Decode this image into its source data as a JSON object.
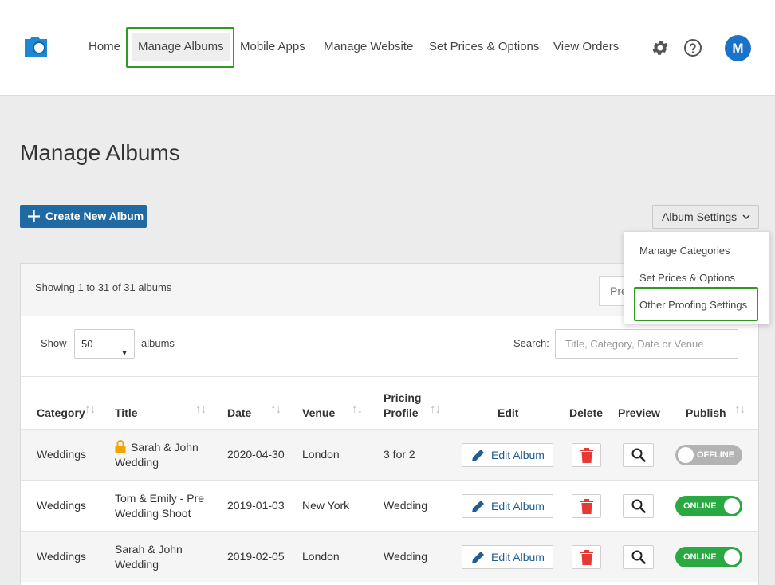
{
  "nav": {
    "items": [
      "Home",
      "Manage Albums",
      "Mobile Apps",
      "Manage Website",
      "Set Prices & Options",
      "View Orders"
    ],
    "active": "Manage Albums"
  },
  "header": {
    "settings_icon": "gear-icon",
    "help_icon": "help-icon",
    "avatar_letter": "M",
    "avatar_color": "#1a73c9"
  },
  "page": {
    "title": "Manage Albums"
  },
  "actions": {
    "create_label": "Create New Album",
    "settings_label": "Album Settings"
  },
  "dropdown": {
    "items": [
      "Manage Categories",
      "Set Prices & Options",
      "Other Proofing Settings"
    ],
    "highlighted": "Other Proofing Settings"
  },
  "table_controls": {
    "showing": "Showing 1 to 31 of 31 albums",
    "preview_partial": "Pre",
    "show_label": "Show",
    "page_size": "50",
    "albums_label": "albums",
    "search_label": "Search:",
    "search_placeholder": "Title, Category, Date or Venue"
  },
  "table": {
    "headers": {
      "category": "Category",
      "title": "Title",
      "date": "Date",
      "venue": "Venue",
      "pricing_1": "Pricing",
      "pricing_2": "Profile",
      "edit": "Edit",
      "delete": "Delete",
      "preview": "Preview",
      "publish": "Publish"
    },
    "edit_label": "Edit Album",
    "rows": [
      {
        "category": "Weddings",
        "title_1": "Sarah & John",
        "title_2": "Wedding",
        "locked": true,
        "date": "2020-04-30",
        "venue": "London",
        "pricing": "3 for 2",
        "status": "OFFLINE"
      },
      {
        "category": "Weddings",
        "title_1": "Tom & Emily - Pre",
        "title_2": "Wedding Shoot",
        "locked": false,
        "date": "2019-01-03",
        "venue": "New York",
        "pricing": "Wedding",
        "status": "ONLINE"
      },
      {
        "category": "Weddings",
        "title_1": "Sarah & John",
        "title_2": "Wedding",
        "locked": false,
        "date": "2019-02-05",
        "venue": "London",
        "pricing": "Wedding",
        "status": "ONLINE"
      }
    ]
  },
  "colors": {
    "primary": "#1f6aa3",
    "online": "#2aa842",
    "offline": "#b3b3b3",
    "delete": "#e53935",
    "highlight": "#2e9a1f"
  }
}
